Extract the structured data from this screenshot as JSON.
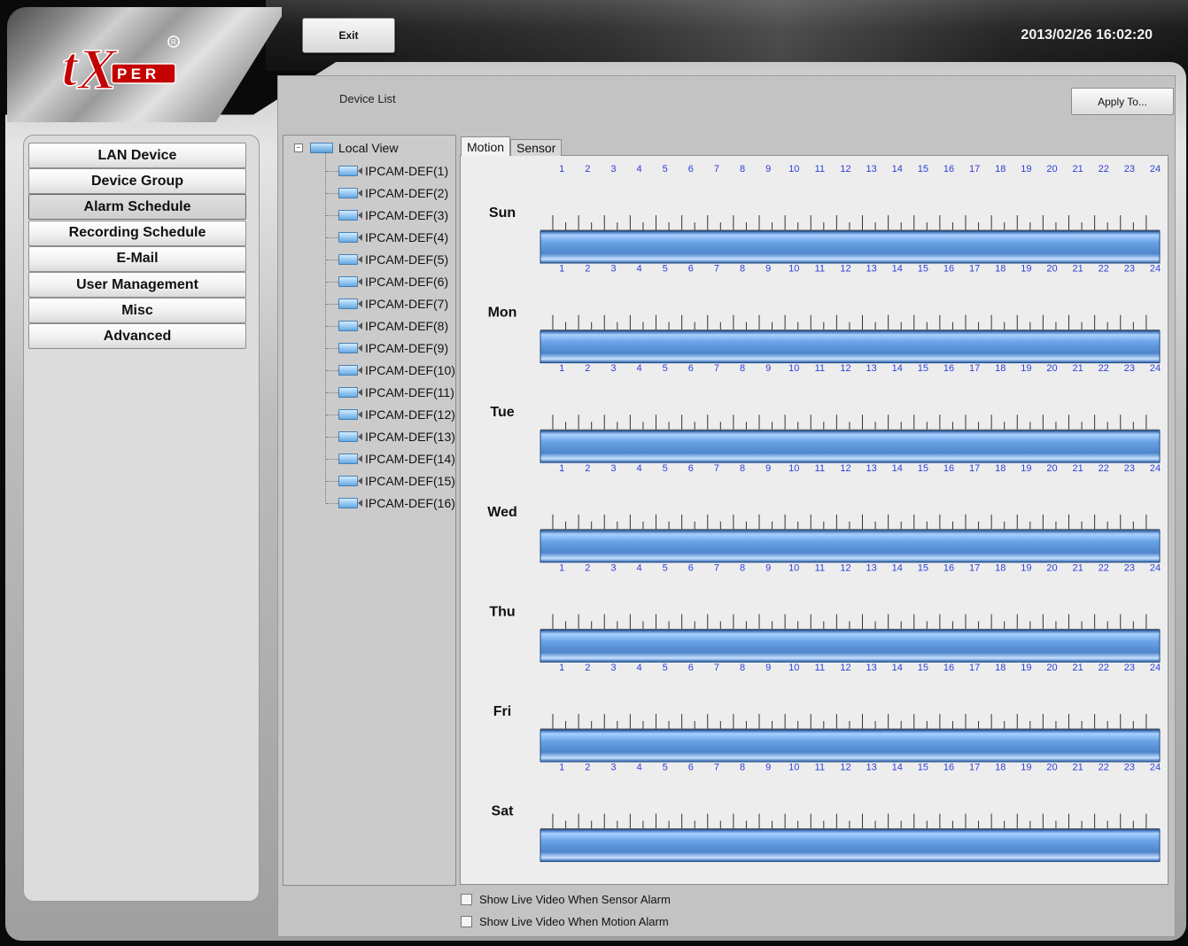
{
  "header": {
    "brand": "tXPER",
    "exit_label": "Exit",
    "datetime": "2013/02/26 16:02:20"
  },
  "sidebar": {
    "items": [
      {
        "label": "LAN Device",
        "active": false
      },
      {
        "label": "Device Group",
        "active": false
      },
      {
        "label": "Alarm Schedule",
        "active": true
      },
      {
        "label": "Recording Schedule",
        "active": false
      },
      {
        "label": "E-Mail",
        "active": false
      },
      {
        "label": "User Management",
        "active": false
      },
      {
        "label": "Misc",
        "active": false
      },
      {
        "label": "Advanced",
        "active": false
      }
    ]
  },
  "content": {
    "device_list_label": "Device List",
    "apply_label": "Apply To..."
  },
  "tree": {
    "root_label": "Local View",
    "devices": [
      "IPCAM-DEF(1)",
      "IPCAM-DEF(2)",
      "IPCAM-DEF(3)",
      "IPCAM-DEF(4)",
      "IPCAM-DEF(5)",
      "IPCAM-DEF(6)",
      "IPCAM-DEF(7)",
      "IPCAM-DEF(8)",
      "IPCAM-DEF(9)",
      "IPCAM-DEF(10)",
      "IPCAM-DEF(11)",
      "IPCAM-DEF(12)",
      "IPCAM-DEF(13)",
      "IPCAM-DEF(14)",
      "IPCAM-DEF(15)",
      "IPCAM-DEF(16)"
    ]
  },
  "tabs": [
    {
      "label": "Motion",
      "active": true
    },
    {
      "label": "Sensor",
      "active": false
    }
  ],
  "schedule": {
    "days": [
      "Sun",
      "Mon",
      "Tue",
      "Wed",
      "Thu",
      "Fri",
      "Sat"
    ],
    "hours": [
      "1",
      "2",
      "3",
      "4",
      "5",
      "6",
      "7",
      "8",
      "9",
      "10",
      "11",
      "12",
      "13",
      "14",
      "15",
      "16",
      "17",
      "18",
      "19",
      "20",
      "21",
      "22",
      "23",
      "24"
    ],
    "enabled_full_day": [
      true,
      true,
      true,
      true,
      true,
      true,
      true
    ],
    "bar_color": "#5b93d3",
    "hour_label_color": "#2b3ed8"
  },
  "options": {
    "sensor_alarm_label": "Show Live Video When Sensor Alarm",
    "sensor_alarm_checked": false,
    "motion_alarm_label": "Show Live Video When Motion Alarm",
    "motion_alarm_checked": false
  }
}
